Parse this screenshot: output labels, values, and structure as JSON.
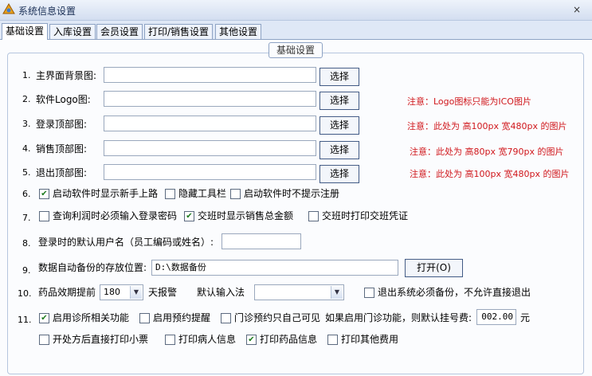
{
  "window": {
    "title": "系统信息设置",
    "close_icon": "×"
  },
  "tabs": [
    {
      "label": "基础设置",
      "active": true
    },
    {
      "label": "入库设置"
    },
    {
      "label": "会员设置"
    },
    {
      "label": "打印/销售设置"
    },
    {
      "label": "其他设置"
    }
  ],
  "group_title": "基础设置",
  "select_button": "选择",
  "rows": {
    "r1": {
      "num": "1.",
      "label": "主界面背景图:",
      "value": ""
    },
    "r2": {
      "num": "2.",
      "label": "软件Logo图:",
      "value": "",
      "note": "注意：Logo图标只能为ICO图片"
    },
    "r3": {
      "num": "3.",
      "label": "登录顶部图:",
      "value": "",
      "note": "注意：此处为 高100px 宽480px 的图片"
    },
    "r4": {
      "num": "4.",
      "label": "销售顶部图:",
      "value": "",
      "note": "注意：此处为 高80px 宽790px 的图片"
    },
    "r5": {
      "num": "5.",
      "label": "退出顶部图:",
      "value": "",
      "note": "注意：此处为 高100px 宽480px 的图片"
    },
    "r6": {
      "num": "6.",
      "options": [
        {
          "label": "启动软件时显示新手上路",
          "checked": true
        },
        {
          "label": "隐藏工具栏",
          "checked": false
        },
        {
          "label": "启动软件时不提示注册",
          "checked": false
        }
      ]
    },
    "r7": {
      "num": "7.",
      "options": [
        {
          "label": "查询利润时必须输入登录密码",
          "checked": false
        },
        {
          "label": "交班时显示销售总金额",
          "checked": true
        },
        {
          "label": "交班时打印交班凭证",
          "checked": false
        }
      ]
    },
    "r8": {
      "num": "8.",
      "label": "登录时的默认用户名（员工编码或姓名）:",
      "value": ""
    },
    "r9": {
      "num": "9.",
      "label": "数据自动备份的存放位置:",
      "value": "D:\\数据备份",
      "button": "打开(O)"
    },
    "r10": {
      "num": "10.",
      "label_prefix": "药品效期提前",
      "days": "180",
      "label_suffix": "天报警",
      "input_method_label": "默认输入法",
      "input_method_value": "",
      "exit_backup": {
        "label": "退出系统必须备份，不允许直接退出",
        "checked": false
      }
    },
    "r11": {
      "num": "11.",
      "options": [
        {
          "label": "启用诊所相关功能",
          "checked": true
        },
        {
          "label": "启用预约提醒",
          "checked": false
        },
        {
          "label": "门诊预约只自己可见",
          "checked": false
        }
      ],
      "fee_label": "如果启用门诊功能，则默认挂号费:",
      "fee_value": "002.00",
      "fee_unit": "元",
      "options2": [
        {
          "label": "开处方后直接打印小票",
          "checked": false
        },
        {
          "label": "打印病人信息",
          "checked": false
        },
        {
          "label": "打印药品信息",
          "checked": true
        },
        {
          "label": "打印其他费用",
          "checked": false
        }
      ]
    }
  },
  "colors": {
    "note": "#d0161b",
    "window_bg": "#dfe8f6",
    "panel_bg": "#fbfcfe"
  }
}
